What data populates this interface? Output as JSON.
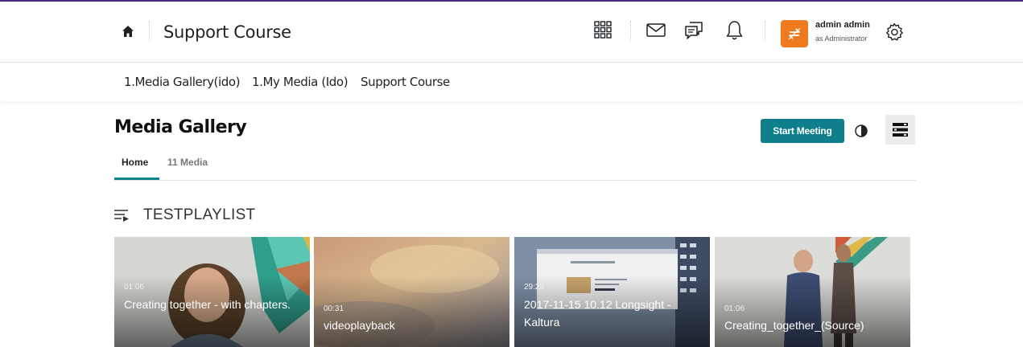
{
  "header": {
    "course_title": "Support Course",
    "user": {
      "name": "admin admin",
      "role": "as Administrator"
    }
  },
  "breadcrumbs": [
    {
      "label": "1.Media Gallery(ido)"
    },
    {
      "label": "1.My Media (Ido)"
    },
    {
      "label": "Support Course"
    }
  ],
  "page": {
    "title": "Media Gallery",
    "start_meeting_label": "Start Meeting",
    "tabs": [
      {
        "label": "Home",
        "active": true
      },
      {
        "label": "11 Media",
        "active": false
      }
    ]
  },
  "playlist": {
    "name": "TESTPLAYLIST",
    "items": [
      {
        "duration": "01:06",
        "title": "Creating together - with chapters."
      },
      {
        "duration": "00:31",
        "title": "videoplayback"
      },
      {
        "duration": "29:23",
        "title": "2017-11-15 10.12 Longsight - Kaltura"
      },
      {
        "duration": "01:06",
        "title": "Creating_together_(Source)"
      }
    ]
  },
  "colors": {
    "accent": "#0f7f8c",
    "avatar": "#f07b1f",
    "top_border": "#4a2a7a"
  },
  "icons": [
    "home-icon",
    "apps-grid-icon",
    "mail-icon",
    "chat-icon",
    "bell-icon",
    "avatar-icon",
    "gear-icon",
    "contrast-icon",
    "menu-icon",
    "playlist-icon"
  ]
}
